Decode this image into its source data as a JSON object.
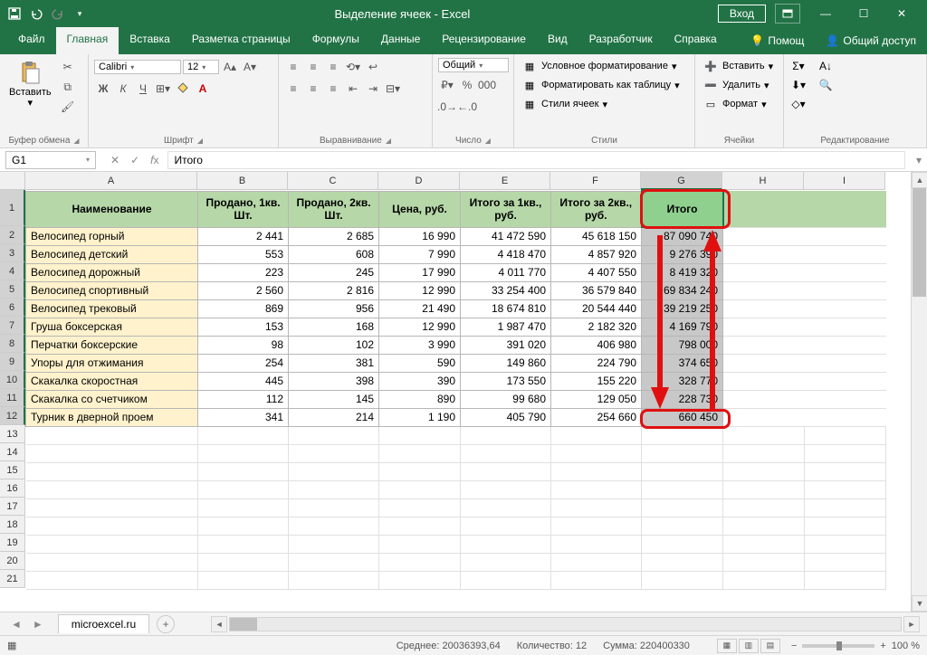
{
  "titlebar": {
    "title": "Выделение ячеек  -  Excel",
    "login": "Вход"
  },
  "tabs": [
    "Файл",
    "Главная",
    "Вставка",
    "Разметка страницы",
    "Формулы",
    "Данные",
    "Рецензирование",
    "Вид",
    "Разработчик",
    "Справка"
  ],
  "tabs_right": {
    "help": "Помощ",
    "share": "Общий доступ"
  },
  "ribbon": {
    "clipboard": {
      "label": "Буфер обмена",
      "paste": "Вставить"
    },
    "font": {
      "label": "Шрифт",
      "name": "Calibri",
      "size": "12"
    },
    "alignment": {
      "label": "Выравнивание"
    },
    "number": {
      "label": "Число",
      "format": "Общий"
    },
    "styles": {
      "label": "Стили",
      "cond": "Условное форматирование",
      "table": "Форматировать как таблицу",
      "cell": "Стили ячеек"
    },
    "cells": {
      "label": "Ячейки",
      "insert": "Вставить",
      "delete": "Удалить",
      "format": "Формат"
    },
    "editing": {
      "label": "Редактирование"
    }
  },
  "namebox": "G1",
  "formula": "Итого",
  "columns": [
    "A",
    "B",
    "C",
    "D",
    "E",
    "F",
    "G",
    "H",
    "I"
  ],
  "headers": [
    "Наименование",
    "Продано, 1кв. Шт.",
    "Продано, 2кв. Шт.",
    "Цена, руб.",
    "Итого за 1кв., руб.",
    "Итого за 2кв., руб.",
    "Итого"
  ],
  "rows": [
    {
      "name": "Велосипед горный",
      "q1": "2 441",
      "q2": "2 685",
      "price": "16 990",
      "t1": "41 472 590",
      "t2": "45 618 150",
      "tot": "87 090 740"
    },
    {
      "name": "Велосипед детский",
      "q1": "553",
      "q2": "608",
      "price": "7 990",
      "t1": "4 418 470",
      "t2": "4 857 920",
      "tot": "9 276 390"
    },
    {
      "name": "Велосипед дорожный",
      "q1": "223",
      "q2": "245",
      "price": "17 990",
      "t1": "4 011 770",
      "t2": "4 407 550",
      "tot": "8 419 320"
    },
    {
      "name": "Велосипед спортивный",
      "q1": "2 560",
      "q2": "2 816",
      "price": "12 990",
      "t1": "33 254 400",
      "t2": "36 579 840",
      "tot": "69 834 240"
    },
    {
      "name": "Велосипед трековый",
      "q1": "869",
      "q2": "956",
      "price": "21 490",
      "t1": "18 674 810",
      "t2": "20 544 440",
      "tot": "39 219 250"
    },
    {
      "name": "Груша боксерская",
      "q1": "153",
      "q2": "168",
      "price": "12 990",
      "t1": "1 987 470",
      "t2": "2 182 320",
      "tot": "4 169 790"
    },
    {
      "name": "Перчатки боксерские",
      "q1": "98",
      "q2": "102",
      "price": "3 990",
      "t1": "391 020",
      "t2": "406 980",
      "tot": "798 000"
    },
    {
      "name": "Упоры для отжимания",
      "q1": "254",
      "q2": "381",
      "price": "590",
      "t1": "149 860",
      "t2": "224 790",
      "tot": "374 650"
    },
    {
      "name": "Скакалка скоростная",
      "q1": "445",
      "q2": "398",
      "price": "390",
      "t1": "173 550",
      "t2": "155 220",
      "tot": "328 770"
    },
    {
      "name": "Скакалка со счетчиком",
      "q1": "112",
      "q2": "145",
      "price": "890",
      "t1": "99 680",
      "t2": "129 050",
      "tot": "228 730"
    },
    {
      "name": "Турник в дверной проем",
      "q1": "341",
      "q2": "214",
      "price": "1 190",
      "t1": "405 790",
      "t2": "254 660",
      "tot": "660 450"
    }
  ],
  "sheet": "microexcel.ru",
  "status": {
    "avg_lbl": "Среднее:",
    "avg": "20036393,64",
    "cnt_lbl": "Количество:",
    "cnt": "12",
    "sum_lbl": "Сумма:",
    "sum": "220400330",
    "zoom": "100 %"
  },
  "chart_data": {
    "type": "table",
    "title": "Итого (selected column G)",
    "categories": [
      "Велосипед горный",
      "Велосипед детский",
      "Велосипед дорожный",
      "Велосипед спортивный",
      "Велосипед трековый",
      "Груша боксерская",
      "Перчатки боксерские",
      "Упоры для отжимания",
      "Скакалка скоростная",
      "Скакалка со счетчиком",
      "Турник в дверной проем"
    ],
    "values": [
      87090740,
      9276390,
      8419320,
      69834240,
      39219250,
      4169790,
      798000,
      374650,
      328770,
      228730,
      660450
    ]
  }
}
